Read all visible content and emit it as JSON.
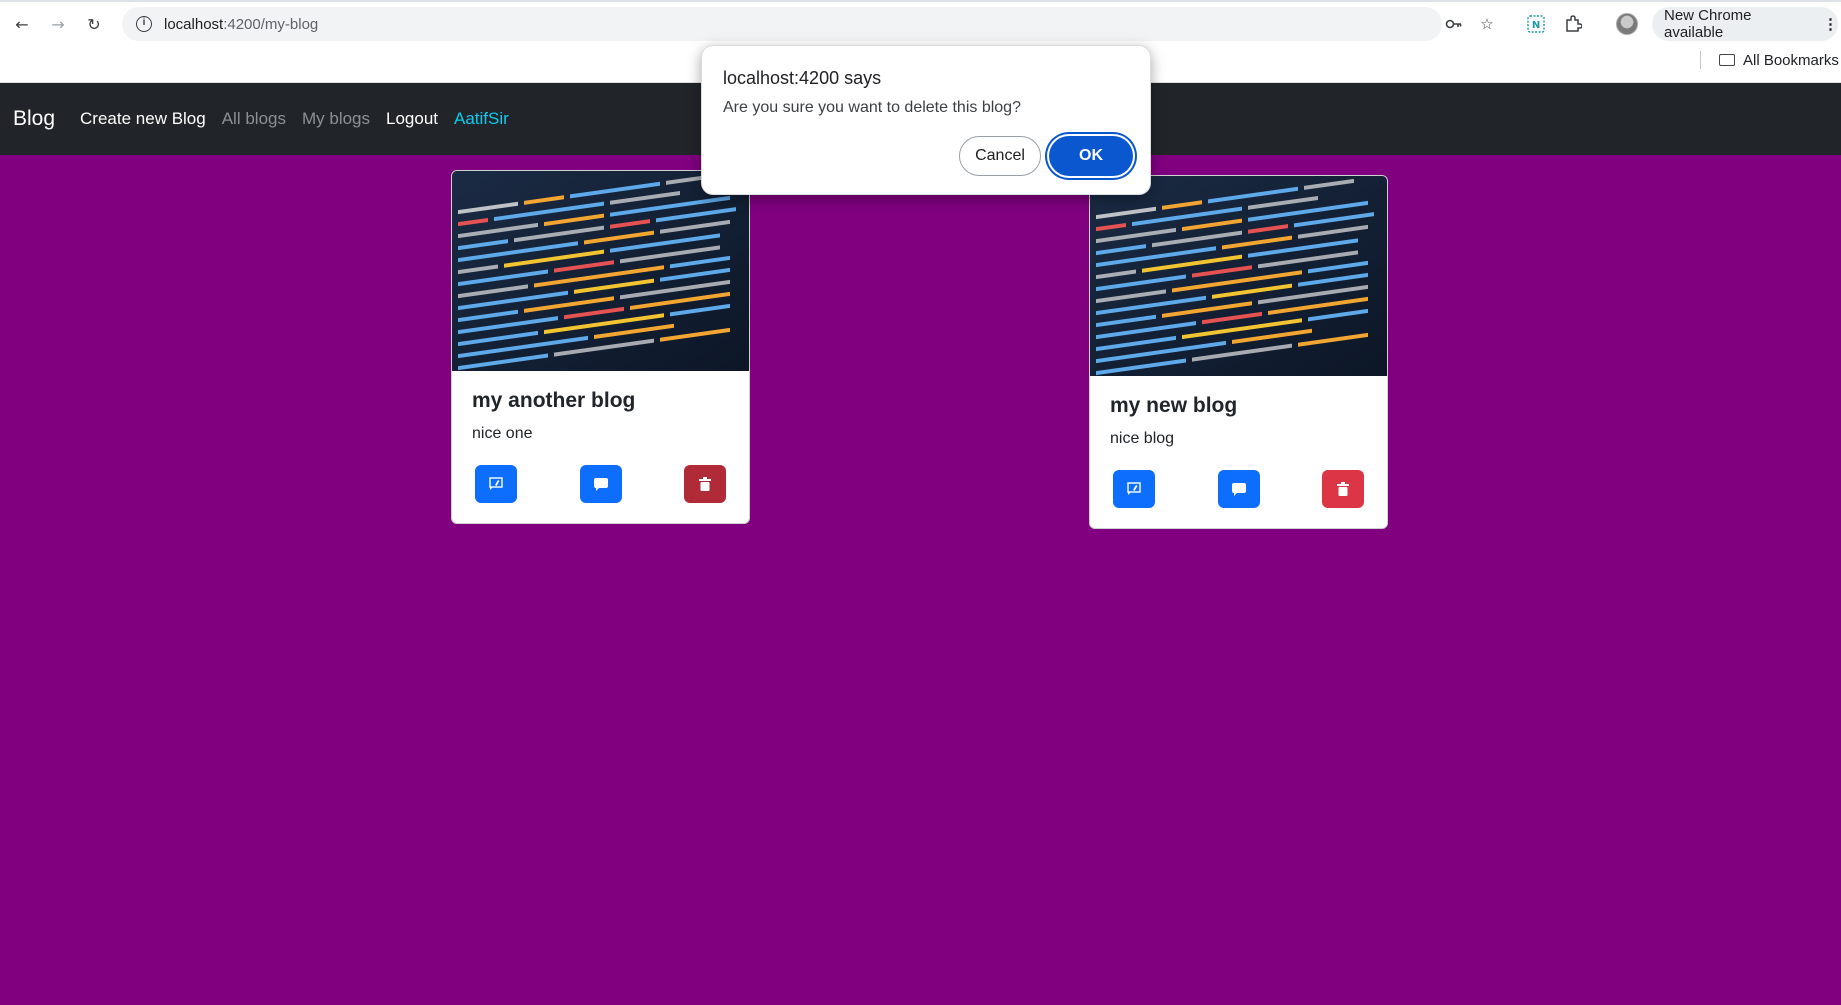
{
  "browser": {
    "url_host": "localhost",
    "url_path": ":4200/my-blog",
    "update_label": "New Chrome available",
    "bookmarks_label": "All Bookmarks"
  },
  "navbar": {
    "brand": "Blog",
    "links": [
      {
        "label": "Create new Blog"
      },
      {
        "label": "All blogs"
      },
      {
        "label": "My blogs"
      },
      {
        "label": "Logout"
      },
      {
        "label": "AatifSir"
      }
    ]
  },
  "cards": [
    {
      "title": "my another blog",
      "text": "nice one"
    },
    {
      "title": "my new blog",
      "text": "nice blog"
    }
  ],
  "dialog": {
    "title": "localhost:4200 says",
    "message": "Are you sure you want to delete this blog?",
    "cancel_label": "Cancel",
    "ok_label": "OK"
  },
  "colors": {
    "page_bg": "#800080",
    "navbar_bg": "#212529",
    "primary": "#0d6efd",
    "danger": "#dc3545",
    "user_link": "#0dcaf0",
    "dialog_ok": "#0b57d0"
  },
  "icons": {
    "edit_button": "message-edit-icon",
    "comment_button": "comment-icon",
    "delete_button": "trash-icon"
  }
}
